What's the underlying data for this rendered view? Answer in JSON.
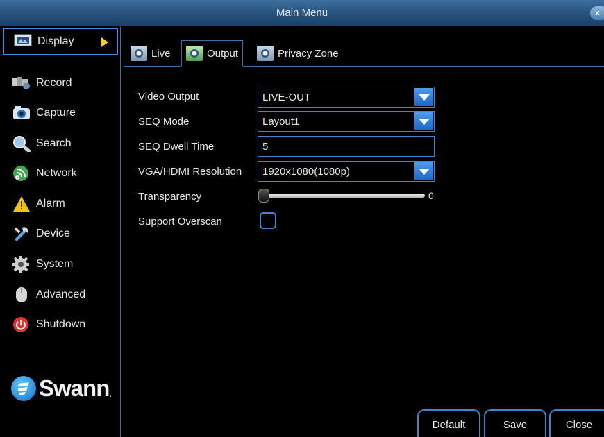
{
  "window": {
    "title": "Main Menu",
    "close_glyph": "×"
  },
  "sidebar": {
    "items": [
      {
        "label": "Display",
        "icon": "display-icon"
      },
      {
        "label": "Record",
        "icon": "record-icon"
      },
      {
        "label": "Capture",
        "icon": "camera-icon"
      },
      {
        "label": "Search",
        "icon": "search-icon"
      },
      {
        "label": "Network",
        "icon": "network-icon"
      },
      {
        "label": "Alarm",
        "icon": "alarm-icon"
      },
      {
        "label": "Device",
        "icon": "device-icon"
      },
      {
        "label": "System",
        "icon": "gear-icon"
      },
      {
        "label": "Advanced",
        "icon": "mouse-icon"
      },
      {
        "label": "Shutdown",
        "icon": "power-icon"
      }
    ],
    "active": "Display"
  },
  "logo": {
    "text": "Swann",
    "registered": "."
  },
  "tabs": [
    {
      "label": "Live"
    },
    {
      "label": "Output"
    },
    {
      "label": "Privacy Zone"
    }
  ],
  "active_tab": "Output",
  "form": {
    "video_output": {
      "label": "Video Output",
      "value": "LIVE-OUT"
    },
    "seq_mode": {
      "label": "SEQ Mode",
      "value": "Layout1"
    },
    "seq_dwell": {
      "label": "SEQ Dwell Time",
      "value": "5"
    },
    "resolution": {
      "label": "VGA/HDMI Resolution",
      "value": "1920x1080(1080p)"
    },
    "transparency": {
      "label": "Transparency",
      "value": "0",
      "level": 0
    },
    "overscan": {
      "label": "Support Overscan",
      "checked": false
    }
  },
  "buttons": {
    "default": "Default",
    "save": "Save",
    "close": "Close"
  },
  "colors": {
    "accent": "#3d86d2",
    "title_bar": "#2a5580",
    "arrow": "#ffd200",
    "background": "#000000"
  }
}
